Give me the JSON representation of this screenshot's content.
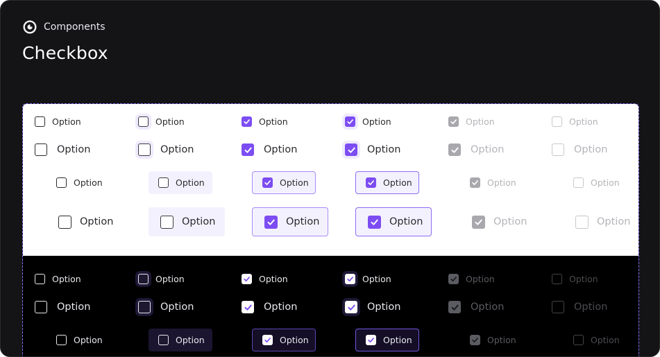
{
  "header": {
    "breadcrumb": "Components",
    "logo_icon": "components-logo-icon",
    "title": "Checkbox"
  },
  "colors": {
    "accent": "#7c4df2",
    "frame_background": "#141416",
    "light_canvas": "#ffffff",
    "dark_canvas": "#000000"
  },
  "option_label": "Option",
  "themes": [
    "light",
    "dark"
  ],
  "states": [
    "default",
    "hover",
    "checked",
    "checked-hover",
    "disabled-checked",
    "disabled"
  ],
  "sizes": [
    "sm",
    "md",
    "lg",
    "xl"
  ],
  "check_icon": "checkmark-icon"
}
